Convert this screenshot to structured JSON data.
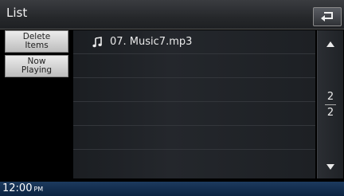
{
  "header": {
    "title": "List"
  },
  "side_buttons": [
    {
      "label": "Delete\nItems"
    },
    {
      "label": "Now\nPlaying"
    }
  ],
  "list": {
    "items": [
      {
        "label": "07. Music7.mp3",
        "icon": "music-note-icon"
      }
    ]
  },
  "pager": {
    "current": "2",
    "total": "2"
  },
  "status": {
    "time": "12:00",
    "ampm": "PM"
  }
}
